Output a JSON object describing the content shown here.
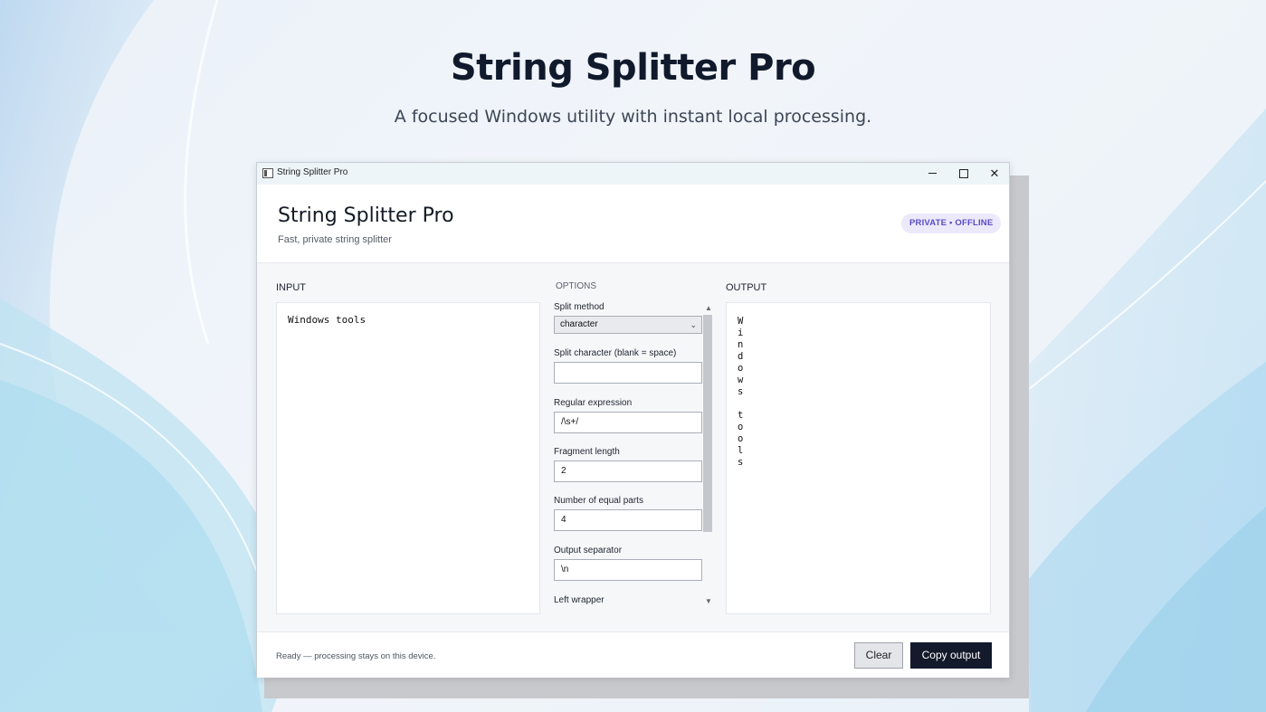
{
  "hero": {
    "title": "String Splitter Pro",
    "subtitle": "A focused Windows utility with instant local processing."
  },
  "window": {
    "title": "String Splitter Pro",
    "controls": {
      "minimize": "–",
      "maximize": "□",
      "close": "✕"
    }
  },
  "header": {
    "title": "String Splitter Pro",
    "subtitle": "Fast, private string splitter",
    "badge": "PRIVATE • OFFLINE"
  },
  "input": {
    "label": "INPUT",
    "text": "Windows tools"
  },
  "options": {
    "label": "OPTIONS",
    "fields": {
      "split_method": {
        "label": "Split method",
        "value": "character"
      },
      "split_character": {
        "label": "Split character (blank = space)",
        "value": ""
      },
      "regex": {
        "label": "Regular expression",
        "value": "/\\s+/"
      },
      "fragment_length": {
        "label": "Fragment length",
        "value": "2"
      },
      "equal_parts": {
        "label": "Number of equal parts",
        "value": "4"
      },
      "output_separator": {
        "label": "Output separator",
        "value": "\\n"
      },
      "left_wrapper": {
        "label": "Left wrapper"
      }
    }
  },
  "output": {
    "label": "OUTPUT",
    "lines": [
      "W",
      "i",
      "n",
      "d",
      "o",
      "w",
      "s",
      "",
      "t",
      "o",
      "o",
      "l",
      "s"
    ]
  },
  "footer": {
    "status": "Ready — processing stays on this device.",
    "clear_label": "Clear",
    "copy_label": "Copy output"
  },
  "colors": {
    "accent_dark": "#131a2b",
    "badge_bg": "#ece9fb",
    "badge_text": "#5b4cc4"
  }
}
